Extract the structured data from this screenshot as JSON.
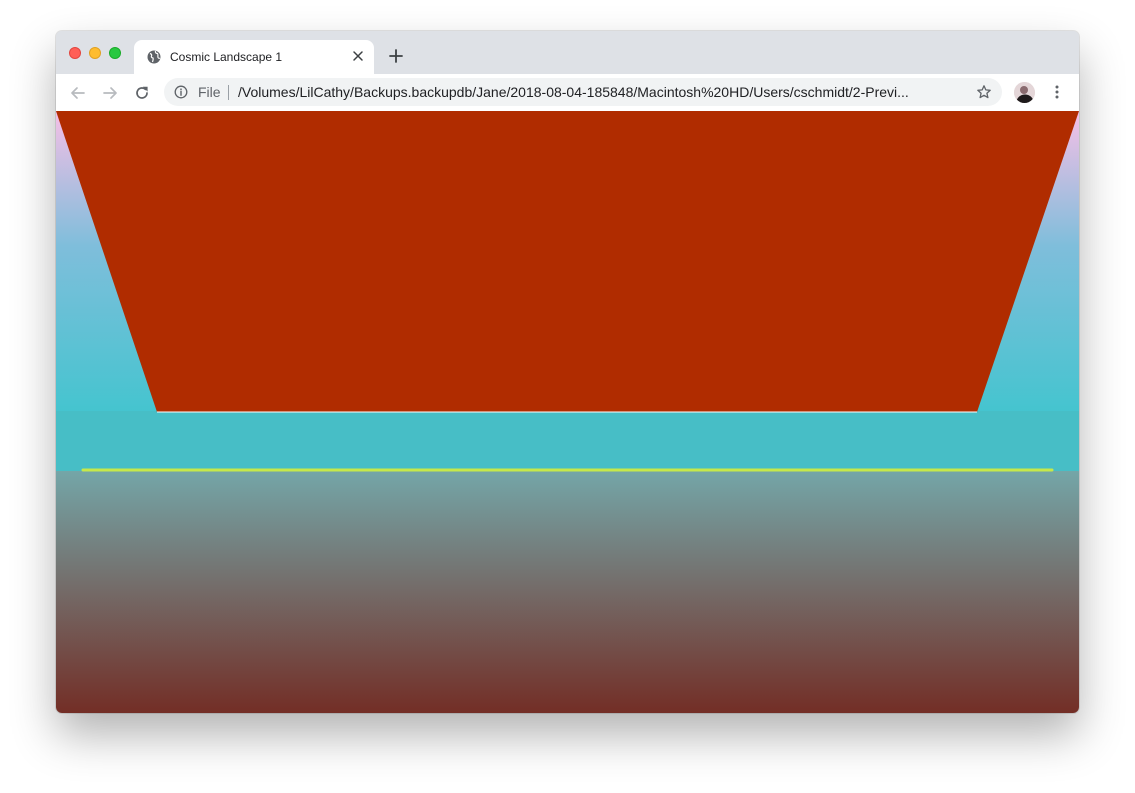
{
  "browser": {
    "tab": {
      "title": "Cosmic Landscape 1",
      "favicon": "globe-icon"
    },
    "address_bar": {
      "scheme_label": "File",
      "url": "/Volumes/LilCathy/Backups.backupdb/Jane/2018-08-04-185848/Macintosh%20HD/Users/cschmidt/2-Previ..."
    },
    "icons": [
      "back-arrow-icon",
      "forward-arrow-icon",
      "reload-icon",
      "info-icon",
      "star-icon",
      "kebab-menu-icon",
      "plus-icon",
      "close-icon"
    ]
  },
  "scene": {
    "colors": {
      "sky_top": "#f6bfe6",
      "sky_mid": "#7fbedb",
      "sky_horizon": "#45c4cf",
      "ground_top": "#74a6a8",
      "ground_bottom": "#732e26",
      "trapezoid": "#b02c00",
      "horizon_line": "#c6e84a"
    }
  }
}
